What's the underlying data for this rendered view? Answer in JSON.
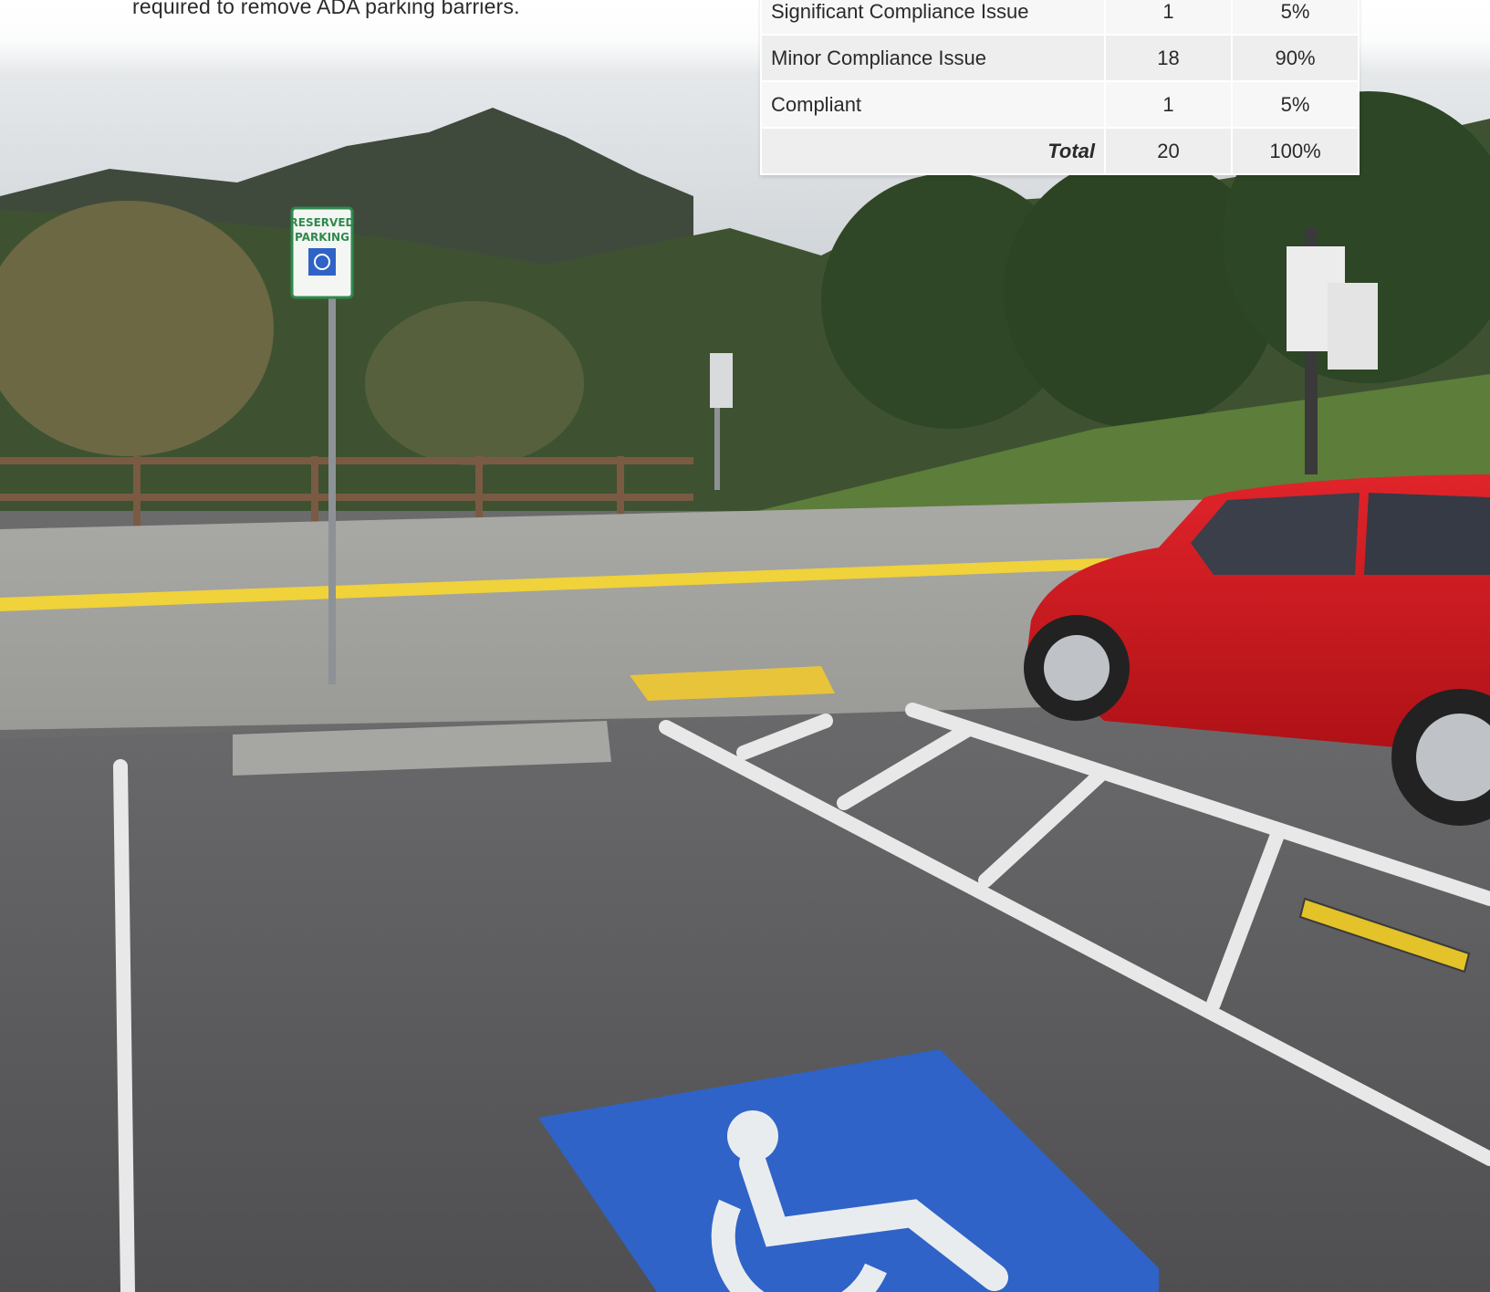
{
  "intro": {
    "text": "required to remove ADA parking barriers."
  },
  "compliance_table": {
    "rows": [
      {
        "label": "Significant Compliance Issue",
        "count": "1",
        "percent": "5%"
      },
      {
        "label": "Minor Compliance Issue",
        "count": "18",
        "percent": "90%"
      },
      {
        "label": "Compliant",
        "count": "1",
        "percent": "5%"
      }
    ],
    "total": {
      "label": "Total",
      "count": "20",
      "percent": "100%"
    }
  },
  "photo": {
    "sign": {
      "line1": "RESERVED",
      "line2": "PARKING"
    }
  },
  "colors": {
    "asphalt": "#5c5c5e",
    "ada_blue": "#2f63c7",
    "car_red": "#d0161c",
    "curb_yellow": "#f0d23a"
  }
}
